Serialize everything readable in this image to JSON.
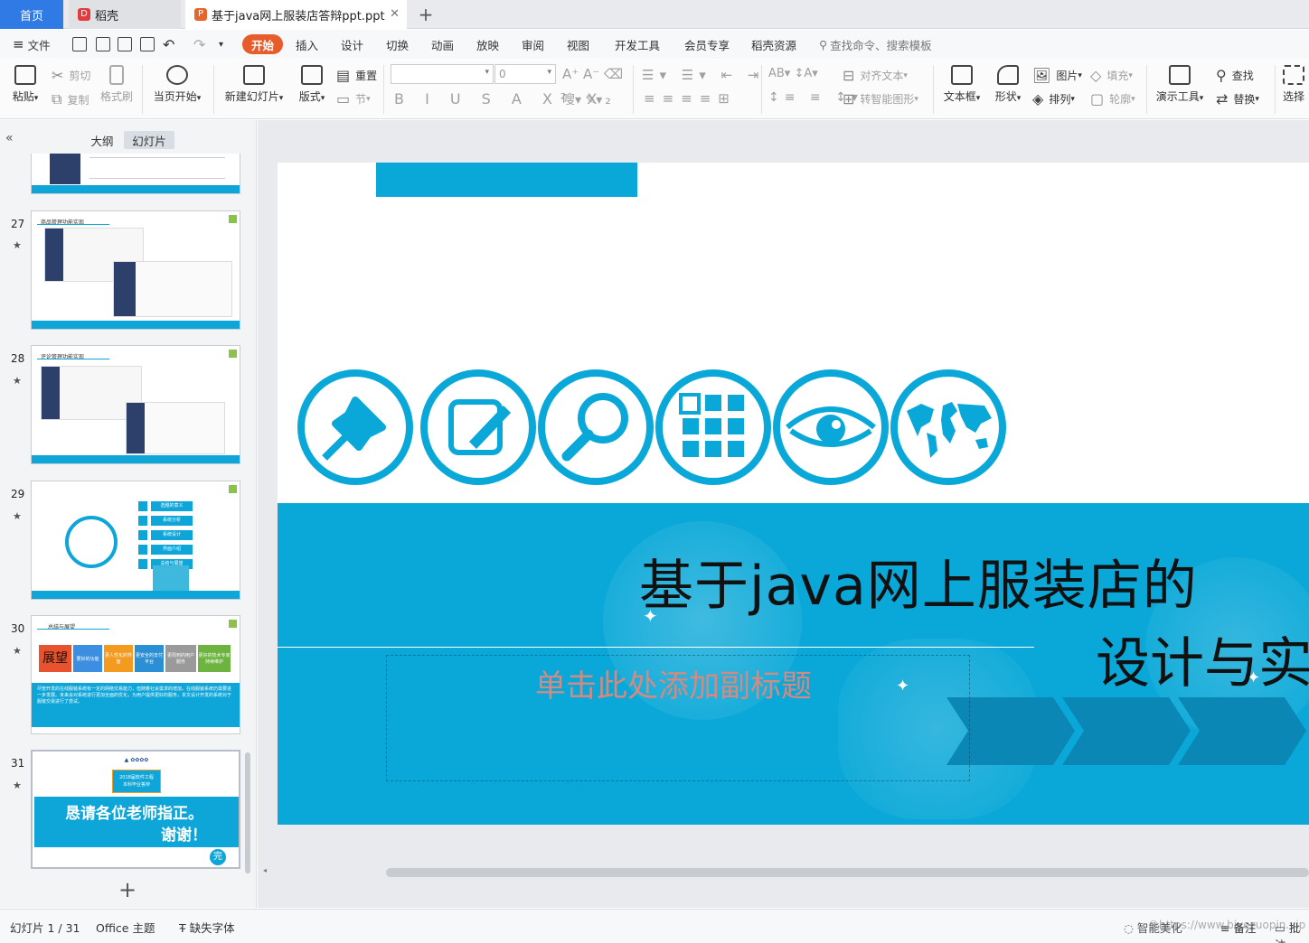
{
  "tabs": {
    "home": "首页",
    "docer": "稻壳",
    "file": "基于java网上服装店答辩ppt.ppt"
  },
  "menu": {
    "file": "文件",
    "items": [
      "开始",
      "插入",
      "设计",
      "切换",
      "动画",
      "放映",
      "审阅",
      "视图",
      "开发工具",
      "会员专享",
      "稻壳资源"
    ],
    "search": "查找命令、搜索模板"
  },
  "ribbon": {
    "paste": "粘贴",
    "cut": "剪切",
    "copy": "复制",
    "format_painter": "格式刷",
    "from_current": "当页开始",
    "new_slide": "新建幻灯片",
    "layout": "版式",
    "reset": "重置",
    "section": "节",
    "font_size": "0",
    "align_text": "对齐文本",
    "smart_art": "转智能图形",
    "text_box": "文本框",
    "shape": "形状",
    "picture": "图片",
    "arrange": "排列",
    "fill": "填充",
    "outline": "轮廓",
    "presenter_tools": "演示工具",
    "find": "查找",
    "replace": "替换",
    "select": "选择"
  },
  "left_panel": {
    "tab_outline": "大纲",
    "tab_slides": "幻灯片",
    "thumbs": [
      {
        "num": "27",
        "title": "商品管理功能实现"
      },
      {
        "num": "28",
        "title": "评论管理功能实现"
      },
      {
        "num": "29",
        "items": [
          "选题的意义",
          "系统分析",
          "系统设计",
          "界面介绍",
          "总结与展望"
        ]
      },
      {
        "num": "30",
        "title": "总结与展望",
        "big": "展望",
        "cards": [
          "要好的功能",
          "更人性化的界面",
          "更安全的支付平台",
          "更周到的用户服务",
          "更好的技术专家持续维护"
        ],
        "text": "尽管开发的在线服装系统有一定的网络交易能力，但随着社会需求的增加，在线服装系统仍需要进一步发展。未来会对系统进行更加全面的优化，为用户提供更好的服务，本文设计开发的系统对于服装交易进行了尝试。"
      },
      {
        "num": "31",
        "line1": "恳请各位老师指正。",
        "line2": "谢谢！",
        "badge": "完",
        "stamp1": "2018届软件工程",
        "stamp2": "本科毕业答辩"
      }
    ]
  },
  "slide": {
    "title_line1": "基于java网上服装店的",
    "title_line2": "设计与实",
    "subtitle_placeholder": "单击此处添加副标题",
    "icons": [
      "pushpin-icon",
      "edit-note-icon",
      "magnifier-icon",
      "grid-icon",
      "eye-icon",
      "world-map-icon"
    ],
    "color_primary": "#0aa8d8"
  },
  "status": {
    "slide_info": "幻灯片 1 / 31",
    "theme": "Office 主题",
    "missing_font": "缺失字体",
    "smart_beautify": "智能美化",
    "notes": "备注",
    "comments": "批注",
    "watermark": "©https://www.biyezuopin.vip"
  }
}
